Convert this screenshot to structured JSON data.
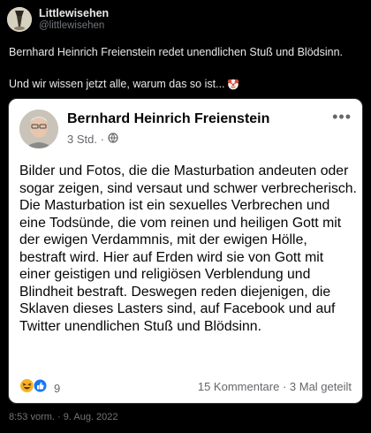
{
  "tweet": {
    "display_name": "Littlewisehen",
    "handle": "@littlewisehen",
    "text_line1": "Bernhard Heinrich Freienstein redet unendlichen Stuß und Blödsinn.",
    "text_line2": "Und wir wissen jetzt alle, warum das so ist...",
    "emoji": "clown-face-icon",
    "timestamp": "8:53 vorm. · 9. Aug. 2022"
  },
  "embedded_post": {
    "author": "Bernhard Heinrich Freienstein",
    "age": "3 Std. ·",
    "audience_icon": "globe-icon",
    "more_icon": "more-dots-icon",
    "body": "Bilder und Fotos, die die Masturbation andeuten oder sogar zeigen, sind versaut und schwer verbrecherisch. Die Masturbation ist ein sexuelles Verbrechen und eine Todsünde, die vom reinen und heiligen Gott mit der ewigen Verdammnis, mit der ewigen Hölle, bestraft wird. Hier auf Erden wird sie von Gott mit einer geistigen und religiösen Verblendung und Blindheit bestraft. Deswegen reden diejenigen, die Sklaven dieses Lasters sind, auf Facebook und auf Twitter unendlichen Stuß und Blödsinn.",
    "reaction_icons": [
      "haha-reaction-icon",
      "like-reaction-icon"
    ],
    "reaction_count": "9",
    "stats": "15 Kommentare · 3 Mal geteilt"
  },
  "colors": {
    "background": "#000000",
    "text_primary": "#e7e9ea",
    "text_secondary": "#71767b",
    "card_background": "#ffffff",
    "fb_secondary": "#65676b",
    "like_blue": "#1877f2",
    "haha_yellow": "#f7b125"
  }
}
